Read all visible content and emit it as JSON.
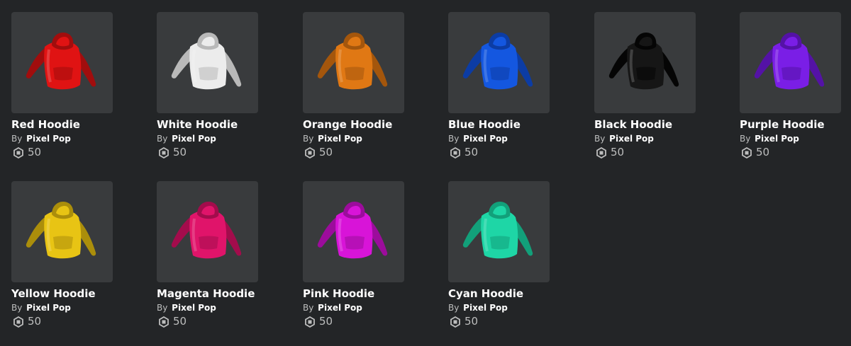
{
  "items": [
    {
      "name": "Red Hoodie",
      "by_label": "By",
      "creator": "Pixel Pop",
      "price": "50",
      "color": "#e01313",
      "shade": "#a10d0d"
    },
    {
      "name": "White Hoodie",
      "by_label": "By",
      "creator": "Pixel Pop",
      "price": "50",
      "color": "#ececec",
      "shade": "#b9b9b9"
    },
    {
      "name": "Orange Hoodie",
      "by_label": "By",
      "creator": "Pixel Pop",
      "price": "50",
      "color": "#e07814",
      "shade": "#a4560c"
    },
    {
      "name": "Blue Hoodie",
      "by_label": "By",
      "creator": "Pixel Pop",
      "price": "50",
      "color": "#1457e0",
      "shade": "#0c3ca4"
    },
    {
      "name": "Black Hoodie",
      "by_label": "By",
      "creator": "Pixel Pop",
      "price": "50",
      "color": "#161616",
      "shade": "#050505"
    },
    {
      "name": "Purple Hoodie",
      "by_label": "By",
      "creator": "Pixel Pop",
      "price": "50",
      "color": "#7a1ee6",
      "shade": "#5412a6"
    },
    {
      "name": "Yellow Hoodie",
      "by_label": "By",
      "creator": "Pixel Pop",
      "price": "50",
      "color": "#e8c414",
      "shade": "#ab8e0b"
    },
    {
      "name": "Magenta Hoodie",
      "by_label": "By",
      "creator": "Pixel Pop",
      "price": "50",
      "color": "#e0146a",
      "shade": "#a30c4c"
    },
    {
      "name": "Pink Hoodie",
      "by_label": "By",
      "creator": "Pixel Pop",
      "price": "50",
      "color": "#d814d8",
      "shade": "#9c0c9c"
    },
    {
      "name": "Cyan Hoodie",
      "by_label": "By",
      "creator": "Pixel Pop",
      "price": "50",
      "color": "#1ed6a6",
      "shade": "#12a07a"
    }
  ],
  "currency_icon": "robux-icon",
  "item_icon": "hoodie-icon"
}
